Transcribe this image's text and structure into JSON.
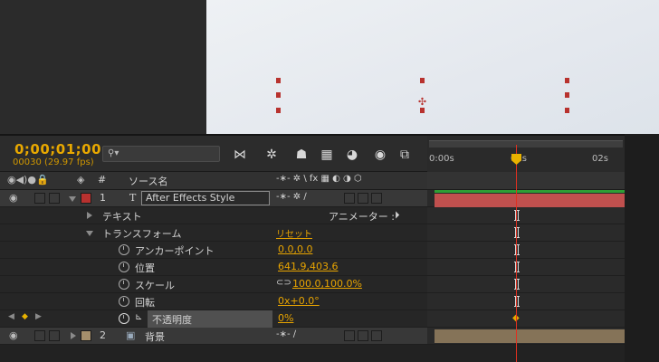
{
  "timeline": {
    "timecode": "0;00;01;00",
    "frames": "00030 (29.97 fps)",
    "search_placeholder": "⚲▾",
    "ruler": {
      "start": "0:00s",
      "mid": "01s",
      "end": "02s"
    }
  },
  "columns": {
    "number": "#",
    "source_name": "ソース名",
    "switches": "-∗- ✲ \\ fx ▦ ◐ ◑ ⬡"
  },
  "layers": [
    {
      "number": "1",
      "type": "T",
      "name": "After Effects Style",
      "color": "#b8312f"
    },
    {
      "number": "2",
      "name": "背景",
      "color": "#a58f6c"
    }
  ],
  "properties": {
    "text_group": "テキスト",
    "animator_label": "アニメーター :",
    "transform_group": "トランスフォーム",
    "reset_label": "リセット",
    "anchor_point": {
      "label": "アンカーポイント",
      "value": "0.0,0.0"
    },
    "position": {
      "label": "位置",
      "value": "641.9,403.6"
    },
    "scale": {
      "label": "スケール",
      "value": "100.0,100.0%"
    },
    "rotation": {
      "label": "回転",
      "value": "0x+0.0°"
    },
    "opacity": {
      "label": "不透明度",
      "value": "0%"
    }
  },
  "colors": {
    "accent": "#e8a800",
    "playhead": "#e03020",
    "layer1_bar": "#c0504e",
    "layer2_bar": "#857358",
    "work_area": "#2e9e35"
  }
}
